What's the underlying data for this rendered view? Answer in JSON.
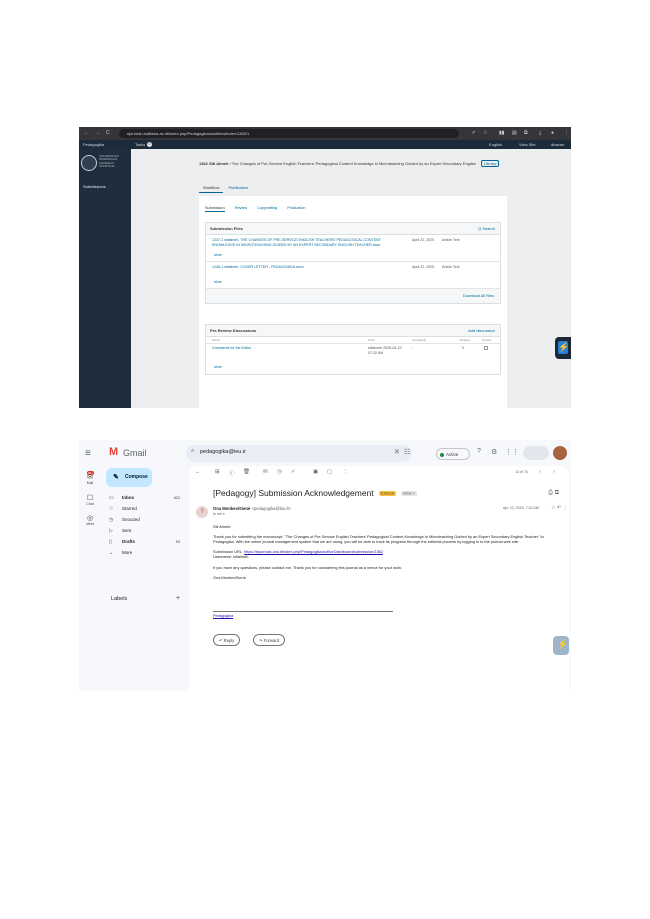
{
  "ojs": {
    "browser": {
      "nav_icons": [
        "←",
        "→",
        "C"
      ],
      "url": "ejournal.undiksha.ac.id/index.php/Pedagogika/workflow/index/1362/1",
      "right_icons": [
        "↗",
        "☆",
        "▮▮",
        "▤",
        "⧉",
        "⤓",
        "●",
        "⋮"
      ]
    },
    "topbar": {
      "journal": "Pedagogika",
      "tasks": "Tasks",
      "tasks_count": "0",
      "lang": "English",
      "view_site": "View Site",
      "user": "dbacan"
    },
    "sidebar": {
      "logo_lines": [
        "UNIVERSITAS",
        "PENDIDIKAN",
        "GANESHA",
        "UNDIKSHA"
      ],
      "item": "Submissions"
    },
    "breadcrumb": {
      "id": "1362",
      "author": "Siti Almeh",
      "title": "/ The Changes of Pre-Service English Teachers' Pedagogical Content Knowledge in Microteaching Guided by an Expert Secondary English",
      "library": "Library"
    },
    "tabs": [
      "Workflow",
      "Publication"
    ],
    "stages": [
      "Submission",
      "Review",
      "Copyediting",
      "Production"
    ],
    "submission_files": {
      "title": "Submission Files",
      "search": "Q Search",
      "files": [
        {
          "name": "1247-1  sitialmeh, THE CHANGES OF PRE-SERVICE ENGLISH TEACHERS' PEDAGOGICAL CONTENT KNOWLEDGE IN MICROTEACHING GUIDED BY AN EXPERT SECONDARY ENGLISH TEACHER.docx",
          "date": "April 22, 2025",
          "type": "Article Text",
          "more": "More"
        },
        {
          "name": "1248-1  sitialmeh, COVER LETTER - PEDAGOGIKA.docx",
          "date": "April 22, 2025",
          "type": "Article Text",
          "more": "More"
        }
      ],
      "download_all": "Download All Files"
    },
    "discussions": {
      "title": "Pre-Review Discussions",
      "add": "Add discussion",
      "columns": [
        "Name",
        "From",
        "Last Reply",
        "Replies",
        "Closed"
      ],
      "rows": [
        {
          "name": "Comments for the Editor",
          "from": "sitialmeh 2025-04-22 07:32 AM",
          "last_reply": "-",
          "replies": "0",
          "more": "More"
        }
      ]
    },
    "float_icon": "⚡"
  },
  "gmail": {
    "menu_icon": "≡",
    "logo_mark": "M",
    "brand": "Gmail",
    "search_value": "pedagogika@ieu.ir",
    "search_icon": "⌕",
    "clear_icon": "✕",
    "tune_icon": "☷",
    "status": "Active",
    "header_icons": [
      "?",
      "⚙",
      "⋮⋮"
    ],
    "rail": [
      {
        "icon": "✉",
        "label": "Mail",
        "badge": "99+"
      },
      {
        "icon": "☐",
        "label": "Chat"
      },
      {
        "icon": "◎",
        "label": "Meet"
      }
    ],
    "compose": "Compose",
    "compose_icon": "✎",
    "nav": [
      {
        "icon": "▭",
        "label": "Inbox",
        "count": "822"
      },
      {
        "icon": "☆",
        "label": "Starred",
        "count": ""
      },
      {
        "icon": "◷",
        "label": "Snoozed",
        "count": ""
      },
      {
        "icon": "▷",
        "label": "Sent",
        "count": ""
      },
      {
        "icon": "▯",
        "label": "Drafts",
        "count": "53"
      },
      {
        "icon": "⌄",
        "label": "More",
        "count": ""
      }
    ],
    "labels_title": "Labels",
    "labels_plus": "+",
    "toolbar": {
      "icons": [
        "←",
        "⊞",
        "ⓘ",
        "🗑",
        "✉",
        "◷",
        "✓",
        "▣",
        "▢",
        "⋮"
      ],
      "pager": "14 of 74",
      "prev": "‹",
      "next": "›"
    },
    "message": {
      "subject": "[Pedagogy] Submission Acknowledgement",
      "label_external": "External",
      "label_inbox": "Inbox ×",
      "subject_icons": "⎙  ⧉",
      "avatar": "?",
      "sender_name": "Ona MonkeviSienė",
      "sender_email": "<pedagogika@leu.lt>",
      "to": "to me ▾",
      "date": "Apr 22, 2025, 7:32 AM",
      "detail_icons": "☆  ↶  ⋮",
      "greeting": "Siti Almeh:",
      "para1": "Thank you for submitting the manuscript, \"The Changes of Pre-Service English Teachers' Pedagogical Content Knowledge in Microteaching Guided by an Expert Secondary English Teacher\" to Pedagogika. With the online journal management system that we are using, you will be able to track its progress through the editorial process by logging in to the journal web site:",
      "url_label": "Submission URL:",
      "url": "https://ejournals.vdu.lt/index.php/Pedagogika/authorDashboard/submission/1362",
      "username": "Username: sitialmeh",
      "para2": "If you have any questions, please contact me. Thank you for considering this journal as a venue for your work.",
      "signature_name": "Ona MonkeviSienė",
      "signature_link": "Pedagogika",
      "reply": "↶ Reply",
      "forward": "↷ Forward"
    },
    "float_icon": "⚡"
  }
}
